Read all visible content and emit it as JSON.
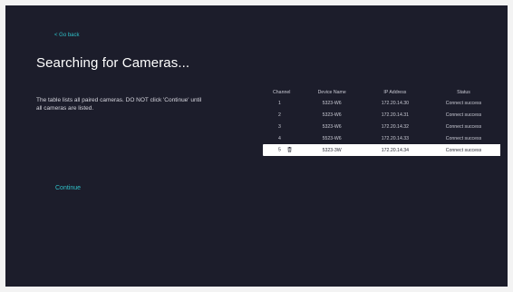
{
  "nav": {
    "back_label": "< Go back"
  },
  "page": {
    "title": "Searching for Cameras...",
    "description": "The table lists all paired cameras. DO NOT click 'Continue' until all cameras are listed.",
    "continue_label": "Continue"
  },
  "table": {
    "headers": [
      "Channel",
      "Device Name",
      "IP Address",
      "Status"
    ],
    "rows": [
      {
        "channel": "1",
        "device": "5323-W6",
        "ip": "172.20.14.30",
        "status": "Connect success"
      },
      {
        "channel": "2",
        "device": "5323-W6",
        "ip": "172.20.14.31",
        "status": "Connect success"
      },
      {
        "channel": "3",
        "device": "5323-W6",
        "ip": "172.20.14.32",
        "status": "Connect success"
      },
      {
        "channel": "4",
        "device": "5523-W6",
        "ip": "172.20.14.33",
        "status": "Connect success"
      },
      {
        "channel": "5",
        "device": "5323-3W",
        "ip": "172.20.14.34",
        "status": "Connect success"
      }
    ],
    "selected_row_index": 4,
    "selected_row_icon": "trash-icon"
  },
  "colors": {
    "background": "#1c1d2b",
    "accent": "#2fc1c9",
    "selected_row": "#ffffff"
  }
}
